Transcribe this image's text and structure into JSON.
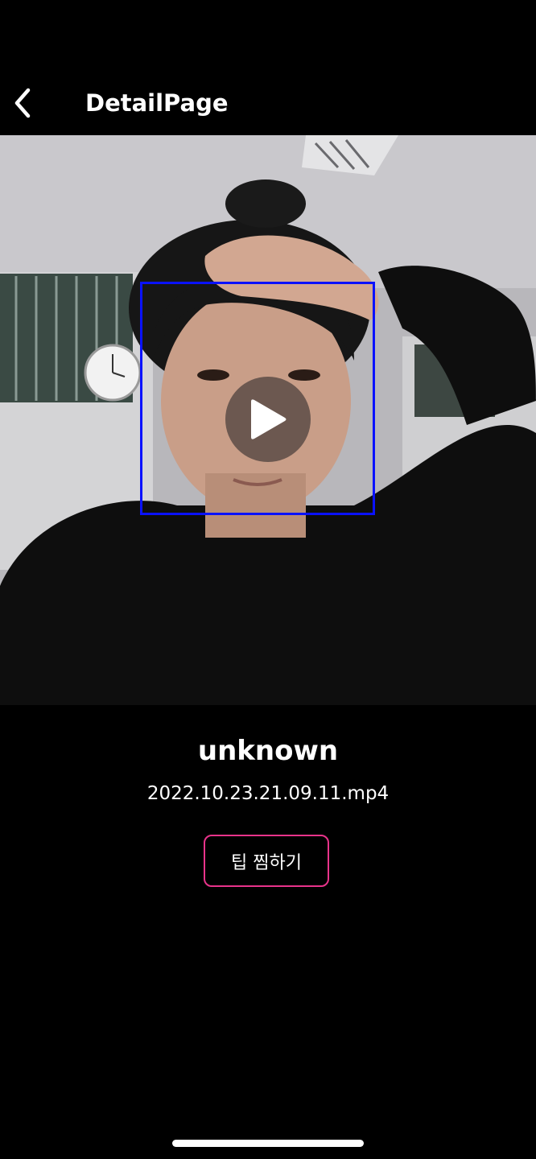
{
  "header": {
    "back_icon": "chevron-left-icon",
    "title": "DetailPage"
  },
  "video": {
    "play_icon": "play-icon",
    "face_box_color": "#0a12ff"
  },
  "detail": {
    "name": "unknown",
    "file_name": "2022.10.23.21.09.11.mp4",
    "tip_button_label": "팁 찜하기",
    "tip_button_border_color": "#e8338a"
  }
}
